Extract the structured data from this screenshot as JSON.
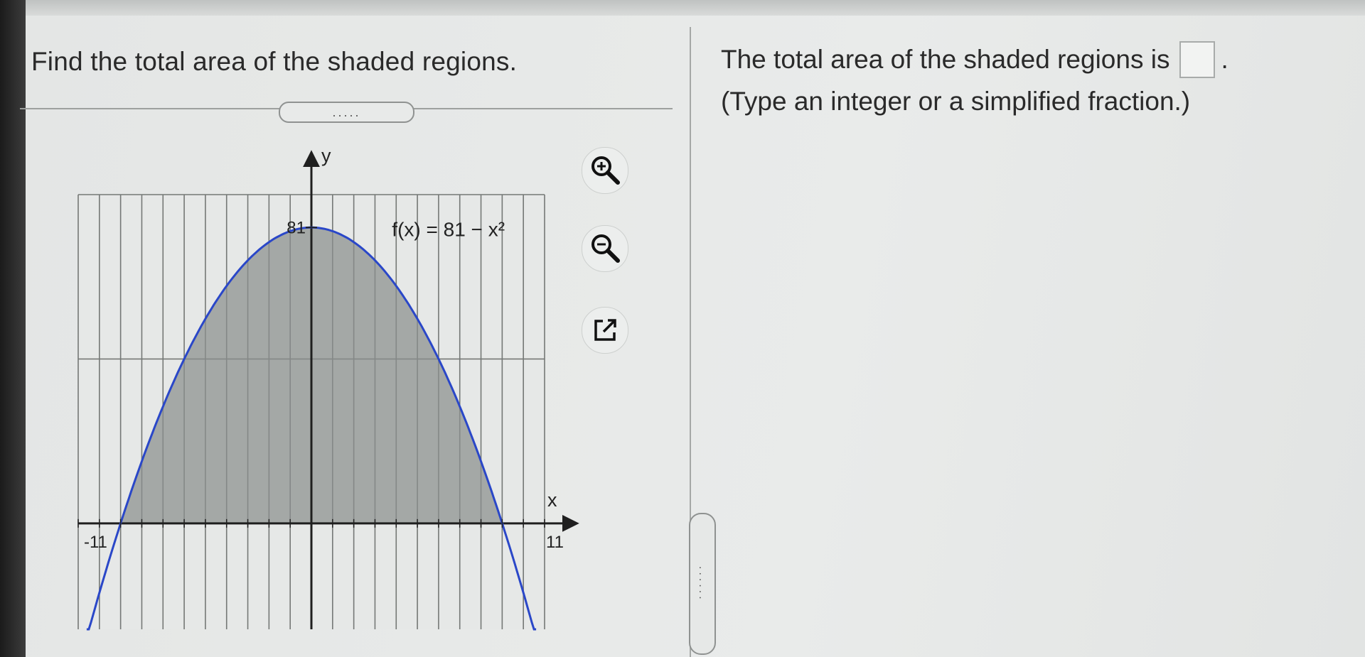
{
  "question": {
    "text": "Find the total area of the shaded regions.",
    "more_indicator": "....."
  },
  "answer": {
    "prompt": "The total area of the shaded regions is",
    "input_value": "",
    "suffix": ".",
    "hint": "(Type an integer or a simplified fraction.)"
  },
  "graph": {
    "function_label": "f(x) = 81 − x²",
    "x_axis_label": "x",
    "y_axis_label": "y",
    "tick_labels": {
      "y_top": "81",
      "x_left": "-11",
      "x_right": "11"
    },
    "x_range": [
      -11,
      11
    ],
    "y_range": [
      -29,
      90
    ],
    "shaded_interval": [
      -9,
      9
    ],
    "colors": {
      "curve": "#2a47c8",
      "shade": "#8b8f8e",
      "grid": "#757876",
      "axis": "#1f1f1f"
    }
  },
  "tools": [
    {
      "name": "zoom-in",
      "icon": "zoom-in-icon"
    },
    {
      "name": "zoom-out",
      "icon": "zoom-out-icon"
    },
    {
      "name": "open-in-new-window",
      "icon": "external-link-icon"
    }
  ],
  "splitter": {
    "handle_text": "......"
  }
}
